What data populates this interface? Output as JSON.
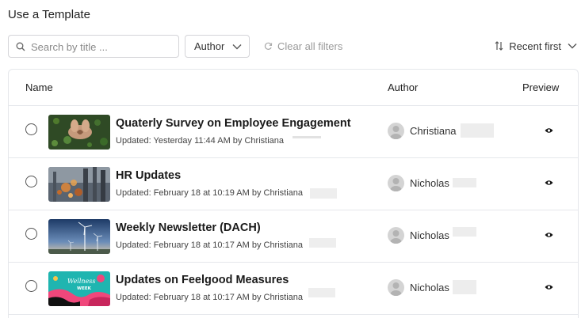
{
  "page": {
    "title": "Use a Template"
  },
  "toolbar": {
    "search_placeholder": "Search by title ...",
    "author_filter_label": "Author",
    "clear_filters_label": "Clear all filters",
    "sort_label": "Recent first"
  },
  "table": {
    "columns": {
      "name": "Name",
      "author": "Author",
      "preview": "Preview"
    },
    "rows": [
      {
        "title": "Quaterly Survey on Employee Engagement",
        "updated": "Updated: Yesterday 11:44 AM by Christiana",
        "author": "Christiana"
      },
      {
        "title": "HR Updates",
        "updated": "Updated: February 18 at 10:19 AM by Christiana",
        "author": "Nicholas"
      },
      {
        "title": "Weekly Newsletter (DACH)",
        "updated": "Updated: February 18 at 10:17 AM by Christiana",
        "author": "Nicholas"
      },
      {
        "title": "Updates on Feelgood Measures",
        "updated": "Updated: February 18 at 10:17 AM by Christiana",
        "author": "Nicholas",
        "thumb_text": "Wellness WEEK"
      }
    ]
  },
  "colors": {
    "border": "#e5e7eb",
    "text": "#1a1a1a",
    "muted": "#9a9a9a",
    "accent_pink": "#f0477b"
  }
}
